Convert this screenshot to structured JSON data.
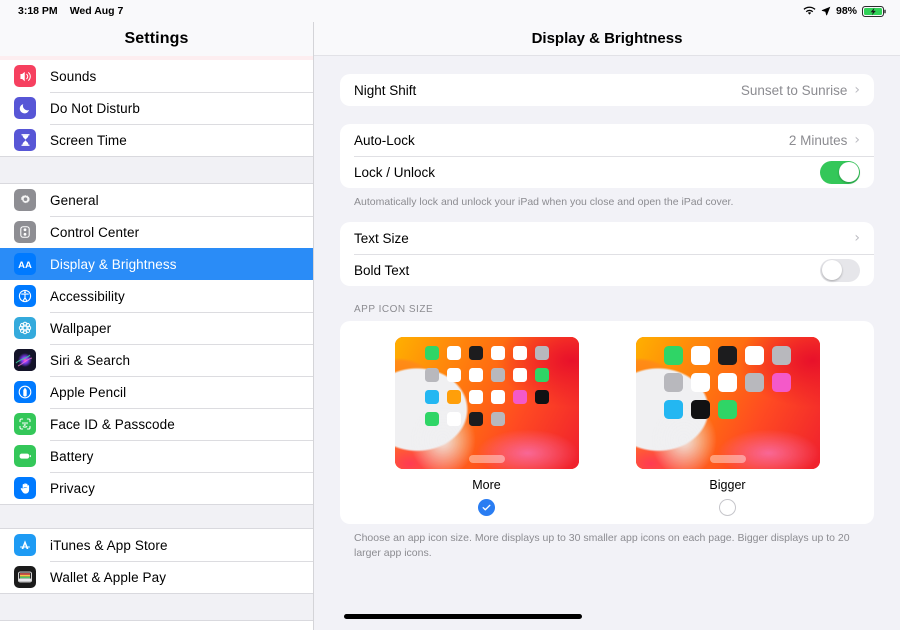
{
  "statusbar": {
    "time": "3:18 PM",
    "date": "Wed Aug 7",
    "battery_percent": "98%",
    "wifi_icon": "wifi-icon",
    "location_icon": "location-arrow-icon",
    "battery_icon": "battery-charging-icon"
  },
  "sidebar": {
    "title": "Settings",
    "groups": [
      {
        "items": [
          {
            "label": "Sounds",
            "icon": "speaker-icon",
            "color": "#f6405f",
            "selected": false
          },
          {
            "label": "Do Not Disturb",
            "icon": "moon-icon",
            "color": "#5756d6",
            "selected": false
          },
          {
            "label": "Screen Time",
            "icon": "hourglass-icon",
            "color": "#5756d6",
            "selected": false
          }
        ]
      },
      {
        "items": [
          {
            "label": "General",
            "icon": "gear-icon",
            "color": "#8e8e93",
            "selected": false
          },
          {
            "label": "Control Center",
            "icon": "sliders-icon",
            "color": "#8e8e93",
            "selected": false
          },
          {
            "label": "Display & Brightness",
            "icon": "aa-text-icon",
            "color": "#007aff",
            "selected": true
          },
          {
            "label": "Accessibility",
            "icon": "accessibility-icon",
            "color": "#007aff",
            "selected": false
          },
          {
            "label": "Wallpaper",
            "icon": "flower-icon",
            "color": "#34aadc",
            "selected": false
          },
          {
            "label": "Siri & Search",
            "icon": "siri-icon",
            "color": "#1b1b2a",
            "selected": false
          },
          {
            "label": "Apple Pencil",
            "icon": "pencil-circle-icon",
            "color": "#007aff",
            "selected": false
          },
          {
            "label": "Face ID & Passcode",
            "icon": "face-id-icon",
            "color": "#34c759",
            "selected": false
          },
          {
            "label": "Battery",
            "icon": "battery-icon",
            "color": "#34c759",
            "selected": false
          },
          {
            "label": "Privacy",
            "icon": "hand-icon",
            "color": "#007aff",
            "selected": false
          }
        ]
      },
      {
        "items": [
          {
            "label": "iTunes & App Store",
            "icon": "app-store-icon",
            "color": "#1e9bf4",
            "selected": false
          },
          {
            "label": "Wallet & Apple Pay",
            "icon": "wallet-icon",
            "color": "#1b1b1b",
            "selected": false
          }
        ]
      }
    ]
  },
  "detail": {
    "title": "Display & Brightness",
    "night_shift": {
      "label": "Night Shift",
      "value": "Sunset to Sunrise",
      "chevron": "chevron-right-icon"
    },
    "auto_lock": {
      "label": "Auto-Lock",
      "value": "2 Minutes",
      "chevron": "chevron-right-icon"
    },
    "lock_unlock": {
      "label": "Lock / Unlock",
      "state": "on"
    },
    "lock_unlock_footnote": "Automatically lock and unlock your iPad when you close and open the iPad cover.",
    "text_size": {
      "label": "Text Size",
      "chevron": "chevron-right-icon"
    },
    "bold_text": {
      "label": "Bold Text",
      "state": "off"
    },
    "app_icon_size": {
      "header": "APP ICON SIZE",
      "options": [
        {
          "label": "More",
          "selected": true,
          "columns": 6
        },
        {
          "label": "Bigger",
          "selected": false,
          "columns": 5
        }
      ],
      "footnote": "Choose an app icon size. More displays up to 30 smaller app icons on each page. Bigger displays up to 20 larger app icons."
    }
  },
  "colors": {
    "accent": "#007aff",
    "selected_row": "#2a8cf7",
    "toggle_on": "#34c759",
    "toggle_off": "#e6e6ea",
    "pane_background": "#f2f2f7",
    "card_background": "#ffffff"
  },
  "preview_icons": {
    "more_grid": [
      "#2fd566",
      "#ffffff",
      "#1c1c1e",
      "#ffffff",
      "#ffffff",
      "#b8b8bd",
      "#b8b8bd",
      "#ffffff",
      "#ffffff",
      "#b8b8bd",
      "#ffffff",
      "#2fd566",
      "#23b7f2",
      "#ff9f0a",
      "#ffffff",
      "#ffffff",
      "#f459c9",
      "#111113",
      "#2fd566",
      "#ffffff",
      "#1c1c1e",
      "#b8b8bd",
      "",
      ""
    ],
    "more_dock": [
      "#ffffff",
      "#1c1c1e",
      "#b8b8bd",
      "#ff9f0a",
      "#2fd566"
    ],
    "bigger_grid": [
      "#2fd566",
      "#ffffff",
      "#1c1c1e",
      "#ffffff",
      "#b8b8bd",
      "#b8b8bd",
      "#ffffff",
      "#ffffff",
      "#b8b8bd",
      "#f459c9",
      "#23b7f2",
      "#111113",
      "#2fd566",
      "",
      ""
    ],
    "bigger_dock": [
      "#ffffff",
      "#1c1c1e",
      "#b8b8bd",
      "#ff9f0a",
      "#f459c9"
    ]
  }
}
